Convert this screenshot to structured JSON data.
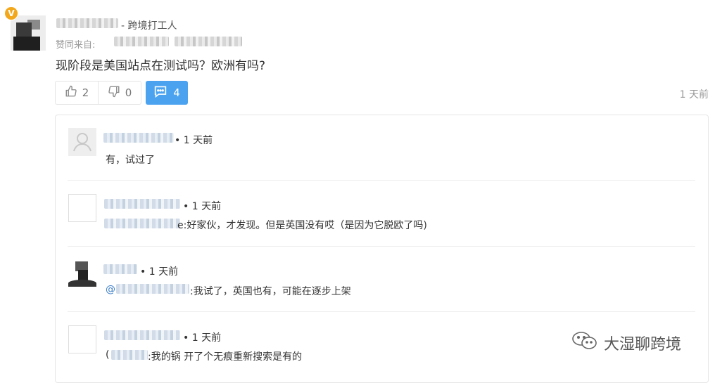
{
  "post": {
    "author_suffix": "- 跨境打工人",
    "badge": "V",
    "from_label": "赞同来自:",
    "question": "现阶段是美国站点在测试吗？欧洲有吗?",
    "upvotes": "2",
    "downvotes": "0",
    "comments": "4",
    "time": "1 天前"
  },
  "replies": [
    {
      "time": "• 1 天前",
      "text": "有，试过了"
    },
    {
      "time": "• 1 天前",
      "text": "e:好家伙，才发现。但是英国没有哎（是因为它脱欧了吗)"
    },
    {
      "time": "• 1 天前",
      "mention": "@",
      "text": ":我试了，英国也有，可能在逐步上架"
    },
    {
      "time": "• 1 天前",
      "prefix": "(",
      "text": ":我的锅 开了个无痕重新搜索是有的"
    }
  ],
  "watermark": "大湿聊跨境",
  "icons": {
    "upvote": "thumbs-up-icon",
    "downvote": "thumbs-down-icon",
    "comment": "comment-icon",
    "wechat": "wechat-icon"
  },
  "colors": {
    "accent": "#4ba3f0",
    "badge": "#f3a81b",
    "mention": "#3d7ec9"
  }
}
